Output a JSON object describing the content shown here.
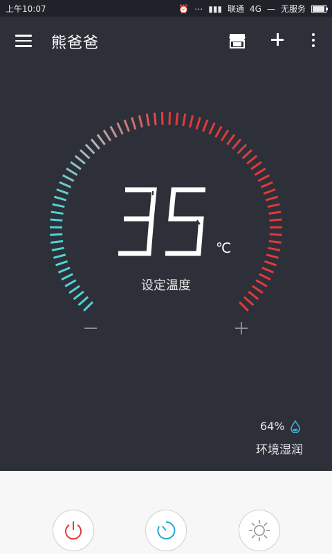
{
  "status_bar": {
    "time": "上午10:07",
    "carrier": "联通",
    "network": "4G",
    "no_service": "无服务"
  },
  "toolbar": {
    "title": "熊爸爸"
  },
  "thermostat": {
    "set_temperature": "35",
    "unit": "℃",
    "set_label": "设定温度",
    "colors": {
      "cool": "#4fd3d8",
      "warm": "#e23a3a",
      "mid": "#b7b7b7"
    }
  },
  "humidity": {
    "value": "64%",
    "label": "环境湿润",
    "icon": "water-drop-icon"
  },
  "controls": {
    "power_icon": "power-icon",
    "timer_icon": "timer-icon",
    "mode_icon": "sun-icon",
    "power_color": "#e03b3b",
    "timer_color": "#2aa6d6",
    "mode_color": "#9a9a9a"
  }
}
